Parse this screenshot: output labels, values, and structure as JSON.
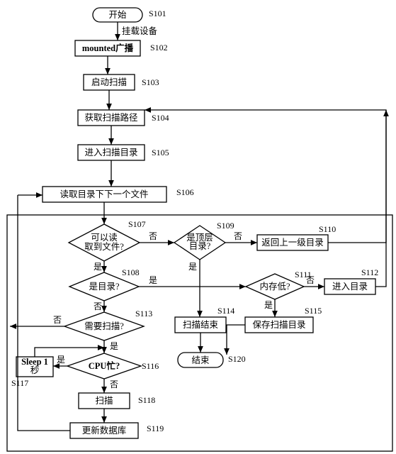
{
  "nodes": {
    "start": {
      "text": "开始",
      "step": "S101"
    },
    "mount": {
      "text": "挂载设备"
    },
    "mounted_broadcast": {
      "text": "mounted广播",
      "step": "S102"
    },
    "start_scan": {
      "text": "启动扫描",
      "step": "S103"
    },
    "get_path": {
      "text": "获取扫描路径",
      "step": "S104"
    },
    "enter_dir": {
      "text": "进入扫描目录",
      "step": "S105"
    },
    "read_next_file": {
      "text": "读取目录下下一个文件",
      "step": "S106"
    },
    "can_read_file": {
      "text": "可以读取到文件?",
      "step": "S107",
      "yes": "是",
      "no": "否"
    },
    "is_dir": {
      "text": "是目录?",
      "step": "S108",
      "yes": "是",
      "no": "否"
    },
    "top_level": {
      "text": "是顶层目录?",
      "step": "S109",
      "yes": "是",
      "no": "否"
    },
    "return_parent": {
      "text": "返回上一级目录",
      "step": "S110"
    },
    "memory_low": {
      "text": "内存低?",
      "step": "S111",
      "yes": "是",
      "no": "否"
    },
    "enter_dir2": {
      "text": "进入目录",
      "step": "S112"
    },
    "need_scan": {
      "text": "需要扫描?",
      "step": "S113",
      "yes": "是",
      "no": "否"
    },
    "scan_end": {
      "text": "扫描结束",
      "step": "S114"
    },
    "save_scan_dir": {
      "text": "保存扫描目录",
      "step": "S115"
    },
    "cpu_busy": {
      "text": "CPU忙?",
      "step": "S116",
      "yes": "是",
      "no": "否"
    },
    "sleep": {
      "text": "Sleep 1 秒",
      "step": "S117"
    },
    "scan": {
      "text": "扫描",
      "step": "S118"
    },
    "update_db": {
      "text": "更新数据库",
      "step": "S119"
    },
    "end": {
      "text": "结束",
      "step": "S120"
    }
  }
}
